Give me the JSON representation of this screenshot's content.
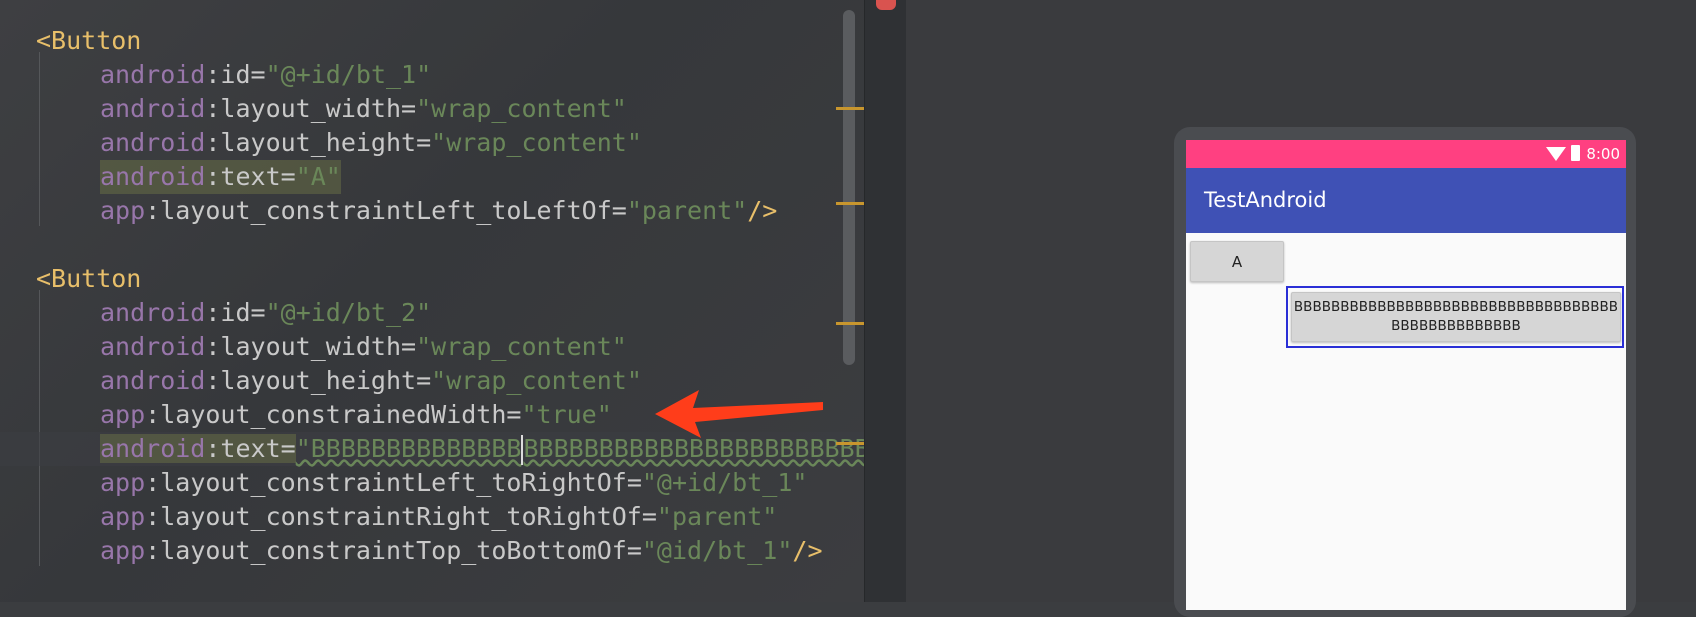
{
  "editor": {
    "block1": {
      "open_tag": "<Button",
      "lines": [
        {
          "ns": "android",
          "attr": "id",
          "value": "\"@+id/bt_1\""
        },
        {
          "ns": "android",
          "attr": "layout_width",
          "value": "\"wrap_content\""
        },
        {
          "ns": "android",
          "attr": "layout_height",
          "value": "\"wrap_content\""
        },
        {
          "ns": "android",
          "attr": "text",
          "value": "\"A\""
        },
        {
          "ns": "app",
          "attr": "layout_constraintLeft_toLeftOf",
          "value": "\"parent\"",
          "close": "/>"
        }
      ]
    },
    "block2": {
      "open_tag": "<Button",
      "lines": [
        {
          "ns": "android",
          "attr": "id",
          "value": "\"@+id/bt_2\""
        },
        {
          "ns": "android",
          "attr": "layout_width",
          "value": "\"wrap_content\""
        },
        {
          "ns": "android",
          "attr": "layout_height",
          "value": "\"wrap_content\""
        },
        {
          "ns": "app",
          "attr": "layout_constrainedWidth",
          "value": "\"true\""
        },
        {
          "ns": "android",
          "attr": "text",
          "value_before_caret": "\"BBBBBBBBBBBBBB",
          "value_after_caret": "BBBBBBBBBBBBBBBBBBBBBBB"
        },
        {
          "ns": "app",
          "attr": "layout_constraintLeft_toRightOf",
          "value": "\"@+id/bt_1\""
        },
        {
          "ns": "app",
          "attr": "layout_constraintRight_toRightOf",
          "value": "\"parent\""
        },
        {
          "ns": "app",
          "attr": "layout_constraintTop_toBottomOf",
          "value": "\"@id/bt_1\"",
          "close": "/>"
        }
      ]
    },
    "colon": ":",
    "equals": "="
  },
  "preview": {
    "status_time": "8:00",
    "app_title": "TestAndroid",
    "button_a_label": "A",
    "button_b_label": "BBBBBBBBBBBBBBBBBBBBBBBBBBBBBBBBBBBBBBBBBBBBBBBBB"
  },
  "colors": {
    "status_bar": "#ff4081",
    "app_bar": "#3f51b5",
    "arrow": "#ff3d1a",
    "selection": "#2a2fd6"
  },
  "icons": [
    "wifi-icon",
    "battery-icon",
    "annotation-arrow-icon"
  ]
}
